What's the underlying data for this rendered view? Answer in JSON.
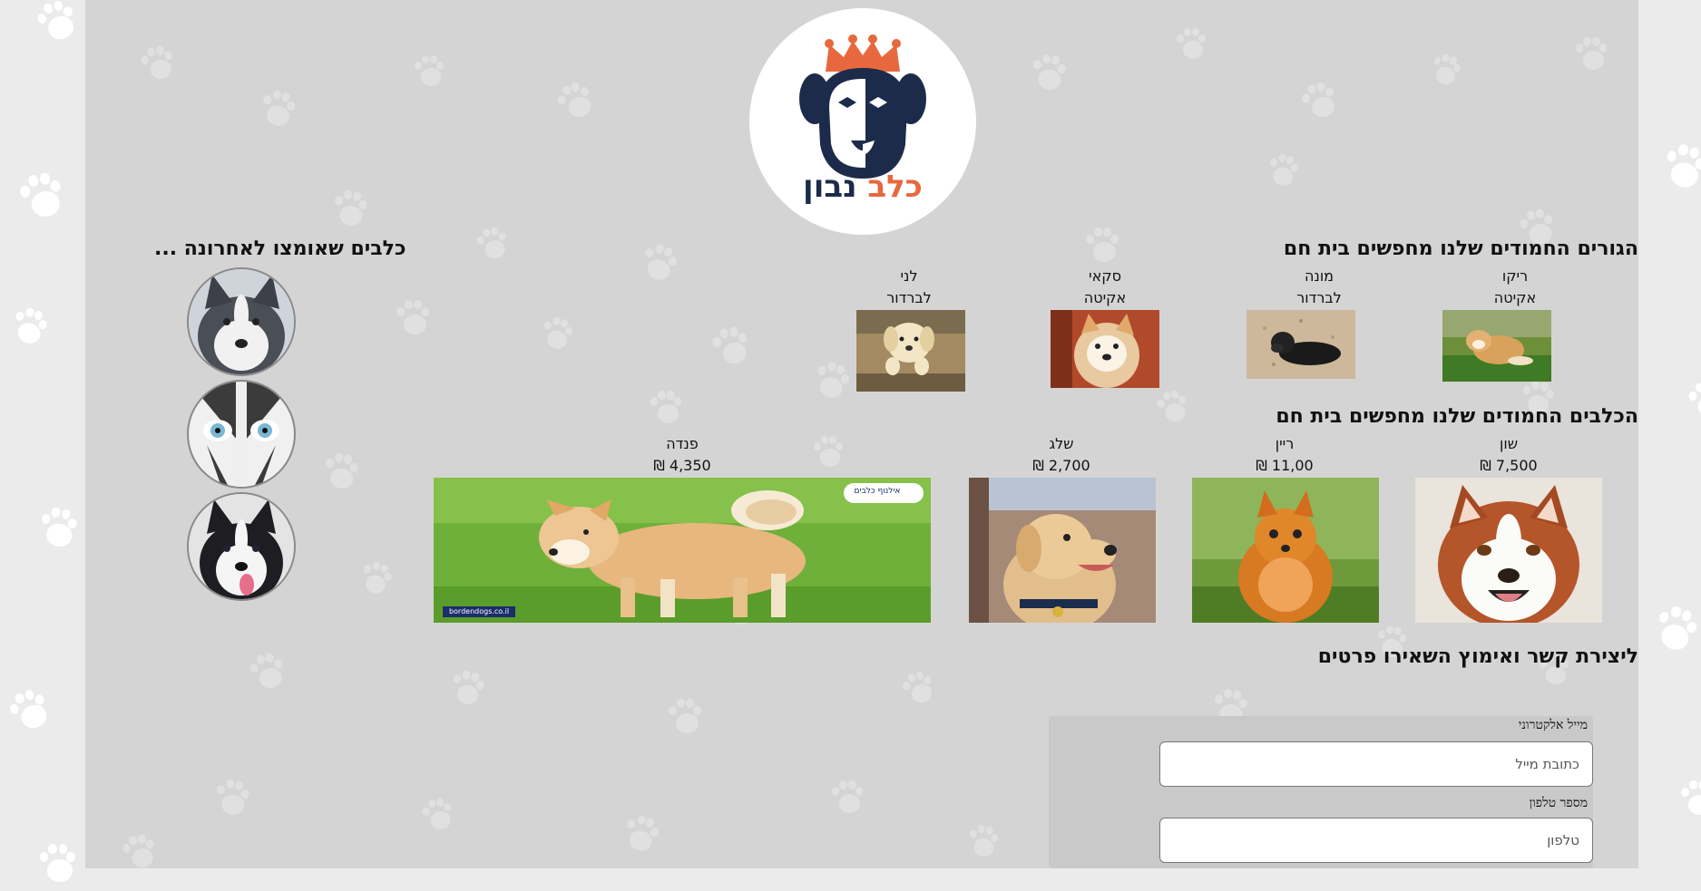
{
  "logo": {
    "word_orange": "כלב",
    "word_navy": "נבון"
  },
  "sections": {
    "puppies_title": "הגורים החמודים שלנו מחפשים בית חם",
    "dogs_title": "הכלבים החמודים שלנו מחפשים בית חם",
    "adopted_title": "כלבים שאומצו לאחרונה ...",
    "contact_title": "ליצירת קשר ואימוץ השאירו פרטים"
  },
  "puppies": [
    {
      "name": "ריקו",
      "breed": "אקיטה"
    },
    {
      "name": "מונה",
      "breed": "לברדור"
    },
    {
      "name": "סקאי",
      "breed": "אקיטה"
    },
    {
      "name": "לני",
      "breed": "לברדור"
    }
  ],
  "dogs": [
    {
      "name": "שון",
      "price": "7,500 ₪"
    },
    {
      "name": "ריין",
      "price": "11,00 ₪"
    },
    {
      "name": "שלג",
      "price": "2,700 ₪"
    },
    {
      "name": "פנדה",
      "price": "4,350 ₪"
    }
  ],
  "panda_watermark": "אילנוף כלבים",
  "panda_site": "bordendogs.co.il",
  "form": {
    "email_label": "מייל אלקטרוני",
    "email_placeholder": "כתובת מייל",
    "phone_label": "מספר טלפון",
    "phone_placeholder": "טלפון"
  },
  "colors": {
    "logo_orange": "#e8683d",
    "logo_navy": "#1d2b4a",
    "page_bg": "#d4d4d4",
    "outer_bg": "#ebebeb"
  }
}
